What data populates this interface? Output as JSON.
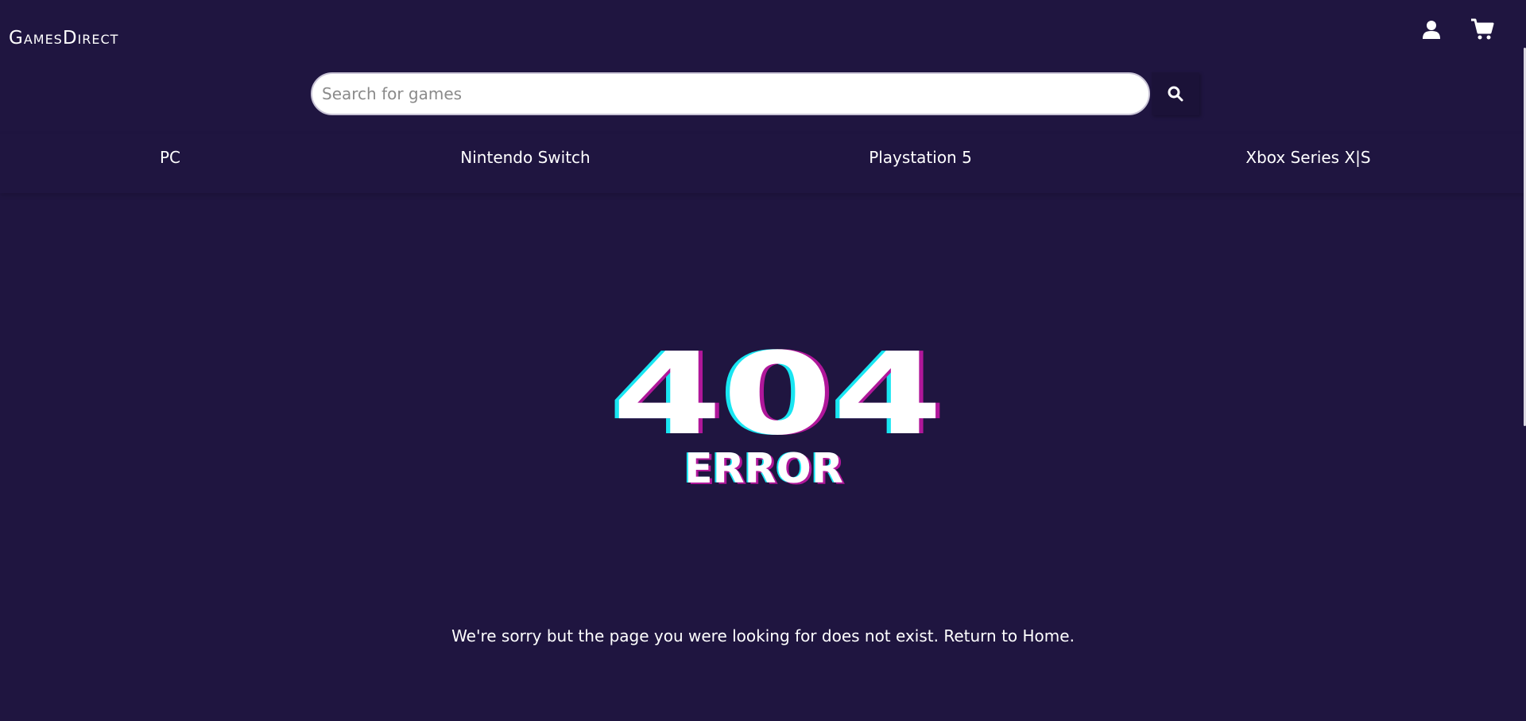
{
  "header": {
    "logo": "GamesDirect",
    "account_icon": "user-icon",
    "cart_icon": "cart-icon"
  },
  "search": {
    "placeholder": "Search for games",
    "value": "",
    "button_icon": "search-icon"
  },
  "nav": {
    "items": [
      {
        "label": "PC"
      },
      {
        "label": "Nintendo Switch"
      },
      {
        "label": "Playstation 5"
      },
      {
        "label": "Xbox Series X|S"
      }
    ]
  },
  "error": {
    "code": "404",
    "label": "ERROR",
    "message": "We're sorry but the page you were looking for does not exist.",
    "home_link": "Return to Home."
  },
  "colors": {
    "background": "#1f1540",
    "glitch_cyan": "#18e6f2",
    "glitch_magenta": "#b0179a",
    "text": "#ffffff"
  }
}
